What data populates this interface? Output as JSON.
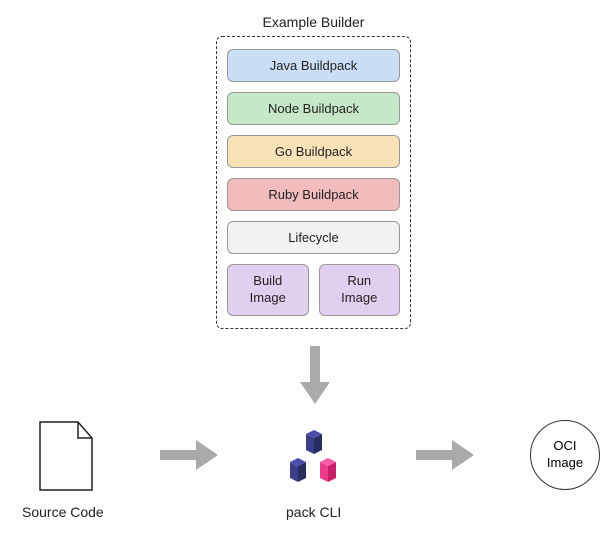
{
  "builder": {
    "title": "Example Builder",
    "buildpacks": {
      "java": "Java Buildpack",
      "node": "Node Buildpack",
      "go": "Go Buildpack",
      "ruby": "Ruby Buildpack"
    },
    "lifecycle": "Lifecycle",
    "images": {
      "build_line1": "Build",
      "build_line2": "Image",
      "run_line1": "Run",
      "run_line2": "Image"
    }
  },
  "source": {
    "label": "Source Code"
  },
  "pack": {
    "label": "pack CLI"
  },
  "oci": {
    "line1": "OCI",
    "line2": "Image"
  }
}
